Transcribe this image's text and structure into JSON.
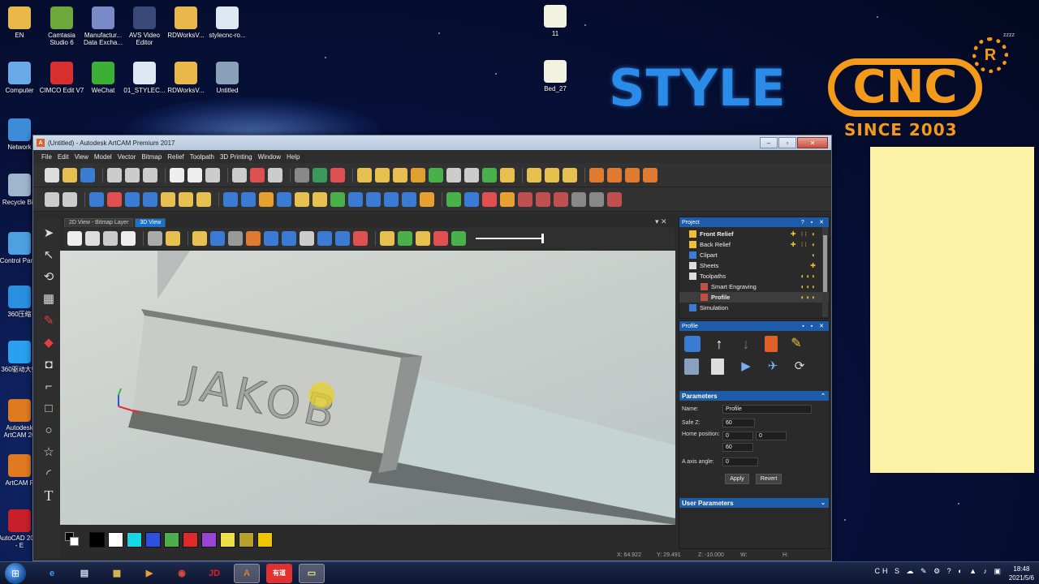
{
  "desktop": {
    "icons_col1": [
      {
        "label": "EN",
        "icon": "folder-icon",
        "color": "#e8b84a"
      },
      {
        "label": "Computer",
        "icon": "computer-icon",
        "color": "#6aa9e8"
      },
      {
        "label": "Network",
        "icon": "network-icon",
        "color": "#3c8cd8"
      },
      {
        "label": "Recycle Bin",
        "icon": "recycle-bin-icon",
        "color": "#9fb6cc"
      },
      {
        "label": "Control Panel",
        "icon": "control-panel-icon",
        "color": "#4fa0e0"
      },
      {
        "label": "360压缩",
        "icon": "360-zip-icon",
        "color": "#2a8fe0"
      },
      {
        "label": "360驱动大师",
        "icon": "360-driver-icon",
        "color": "#2aa0ee"
      },
      {
        "label": "Autodesk ArtCAM 20",
        "icon": "artcam-icon",
        "color": "#e07a20"
      },
      {
        "label": "ArtCAM F",
        "icon": "artcam-icon",
        "color": "#e07a20"
      },
      {
        "label": "AutoCAD 2018 - E",
        "icon": "autocad-icon",
        "color": "#c8202a"
      }
    ],
    "icons_row1": [
      {
        "label": "Camtasia Studio 6",
        "icon": "camtasia-icon",
        "color": "#6da83a"
      },
      {
        "label": "Manufactur... Data Excha...",
        "icon": "manufacturing-icon",
        "color": "#7a8ac8"
      },
      {
        "label": "AVS Video Editor",
        "icon": "avs-video-icon",
        "color": "#3a4a78"
      },
      {
        "label": "RDWorksV...",
        "icon": "rdworks-icon",
        "color": "#e8b84a"
      },
      {
        "label": "stylecnc-ro...",
        "icon": "document-icon",
        "color": "#dfe8f2"
      }
    ],
    "icons_row2": [
      {
        "label": "CIMCO Edit V7",
        "icon": "cimco-icon",
        "color": "#d83030"
      },
      {
        "label": "WeChat",
        "icon": "wechat-icon",
        "color": "#3cb034"
      },
      {
        "label": "01_STYLEC...",
        "icon": "document-icon",
        "color": "#dfe8f2"
      },
      {
        "label": "RDWorksV...",
        "icon": "rdworks-icon",
        "color": "#e8b84a"
      },
      {
        "label": "Untitled",
        "icon": "printer-icon",
        "color": "#8aa0b8"
      }
    ],
    "icons_mid": [
      {
        "label": "11",
        "icon": "certificate-icon"
      },
      {
        "label": "Bed_27",
        "icon": "certificate-icon"
      }
    ],
    "top_right_label": "zzzz"
  },
  "brand": {
    "style": "STYLE",
    "cnc": "CNC",
    "registered": "R",
    "since": "SINCE 2003"
  },
  "window": {
    "title": "(Untitled) - Autodesk ArtCAM Premium 2017",
    "app_icon": "A",
    "minimize": "–",
    "maximize": "▫",
    "close": "✕",
    "menu": [
      "File",
      "Edit",
      "View",
      "Model",
      "Vector",
      "Bitmap",
      "Relief",
      "Toolpath",
      "3D Printing",
      "Window",
      "Help"
    ],
    "tabs": [
      "2D View - Bitmap Layer",
      "3D View"
    ],
    "tab_close": "▾ ✕",
    "viewport_text": "JAKOB",
    "status": {
      "x": "X: 64.922",
      "y": "Y: 29.491",
      "z": "Z: -10.000",
      "w": "W:",
      "h": "H:"
    }
  },
  "palette": {
    "colors": [
      "#000000",
      "#ffffff",
      "#15d8e6",
      "#2f4fe0",
      "#4cae4c",
      "#e02a2a",
      "#9a44d6",
      "#f0e048",
      "#b8a02a",
      "#f0c400"
    ]
  },
  "project_panel": {
    "title": "Project",
    "controls": "? ▪ ✕",
    "items": [
      {
        "label": "Front Relief",
        "bold": true,
        "indent": 0,
        "acts": "✚ ⁝⁝ ◐"
      },
      {
        "label": "Back Relief",
        "bold": false,
        "indent": 0,
        "acts": "✚ ⁝⁝ ◐"
      },
      {
        "label": "Clipart",
        "bold": false,
        "indent": 0,
        "acts": "◐"
      },
      {
        "label": "Sheets",
        "bold": false,
        "indent": 0,
        "acts": "✚"
      },
      {
        "label": "Toolpaths",
        "bold": false,
        "indent": 0,
        "acts": "◐◐◐"
      },
      {
        "label": "Smart Engraving",
        "bold": false,
        "indent": 1,
        "acts": "◐◐◐"
      },
      {
        "label": "Profile",
        "bold": true,
        "indent": 1,
        "acts": "◐◐◐"
      },
      {
        "label": "Simulation",
        "bold": false,
        "indent": 0,
        "acts": ""
      }
    ]
  },
  "profile_panel": {
    "title": "Profile",
    "controls": "▪ ▪ ✕",
    "params_title": "Parameters",
    "user_params_title": "User Parameters",
    "name_label": "Name:",
    "name_value": "Profile",
    "safez_label": "Safe Z:",
    "safez_value": "60",
    "home_label": "Home position:",
    "home_x": "0",
    "home_y": "0",
    "home_z": "60",
    "axis_label": "A axis angle:",
    "axis_value": "0",
    "apply": "Apply",
    "revert": "Revert"
  },
  "taskbar": {
    "start": "⊞",
    "items": [
      {
        "name": "ie-icon",
        "glyph": "e",
        "color": "#3aa0e8"
      },
      {
        "name": "notepad-icon",
        "glyph": "▤",
        "color": "#cfe0f0"
      },
      {
        "name": "explorer-icon",
        "glyph": "▦",
        "color": "#e8c050"
      },
      {
        "name": "media-icon",
        "glyph": "▶",
        "color": "#e8a030"
      },
      {
        "name": "chrome-icon",
        "glyph": "◉",
        "color": "#e04a3a"
      },
      {
        "name": "jd-icon",
        "glyph": "JD",
        "color": "#e02020"
      },
      {
        "name": "artcam-task-icon",
        "glyph": "A",
        "color": "#e07a20"
      },
      {
        "name": "youdao-icon",
        "glyph": "有道",
        "color": "#e03030"
      },
      {
        "name": "sticky-notes-icon",
        "glyph": "▭",
        "color": "#f0e080"
      }
    ],
    "tray": "CH S ☁ ✎ ⚙ ? ◐ ▲ ♪ ▣",
    "time": "18:48",
    "date": "2021/5/6"
  }
}
